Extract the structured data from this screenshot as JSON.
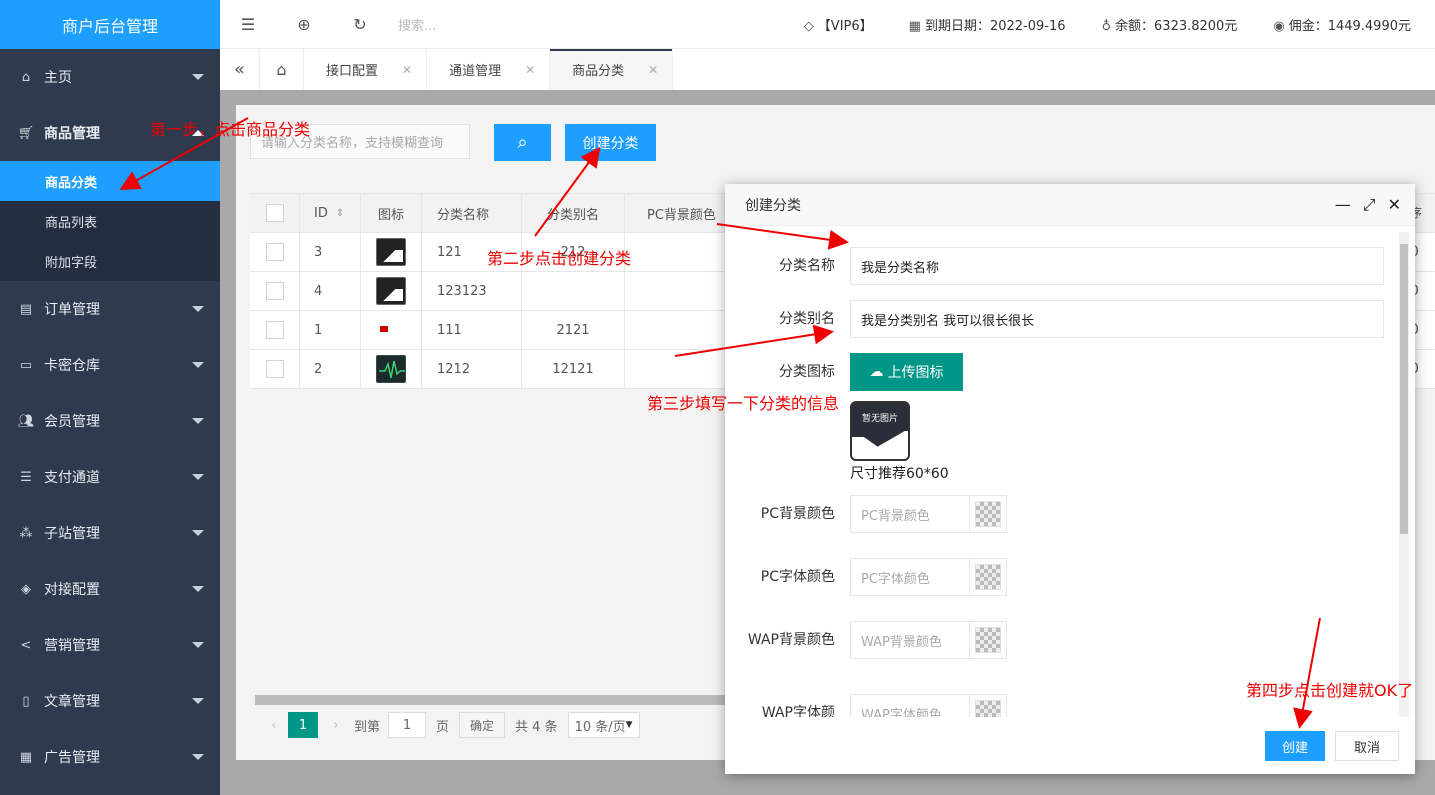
{
  "app": {
    "title": "商户后台管理"
  },
  "sidebar": {
    "items": [
      {
        "label": "主页",
        "icon": "home-icon"
      },
      {
        "label": "商品管理",
        "icon": "cart-icon",
        "expanded": true,
        "children": [
          {
            "label": "商品分类",
            "active": true
          },
          {
            "label": "商品列表"
          },
          {
            "label": "附加字段"
          }
        ]
      },
      {
        "label": "订单管理",
        "icon": "clipboard-icon"
      },
      {
        "label": "卡密仓库",
        "icon": "card-icon"
      },
      {
        "label": "会员管理",
        "icon": "users-icon"
      },
      {
        "label": "支付通道",
        "icon": "list-icon"
      },
      {
        "label": "子站管理",
        "icon": "sitemap-icon"
      },
      {
        "label": "对接配置",
        "icon": "tag-icon"
      },
      {
        "label": "营销管理",
        "icon": "share-icon"
      },
      {
        "label": "文章管理",
        "icon": "document-icon"
      },
      {
        "label": "广告管理",
        "icon": "calendar-icon"
      }
    ]
  },
  "topbar": {
    "search_placeholder": "搜索...",
    "vip": "【VIP6】",
    "expiry": "到期日期：2022-09-16",
    "balance": "余额：6323.8200元",
    "commission": "佣金：1449.4990元"
  },
  "tabs": [
    {
      "label": "接口配置",
      "active": false
    },
    {
      "label": "通道管理",
      "active": false
    },
    {
      "label": "商品分类",
      "active": true
    }
  ],
  "toolbar": {
    "search_placeholder": "请输入分类名称，支持模糊查询",
    "create_label": "创建分类"
  },
  "table": {
    "headers": {
      "id": "ID",
      "icon": "图标",
      "name": "分类名称",
      "alias": "分类别名",
      "pc_bg": "PC背景颜色",
      "sort": "序"
    },
    "rows": [
      {
        "id": "3",
        "thumb": "mtn",
        "name": "121",
        "alias": "212",
        "sort": "0"
      },
      {
        "id": "4",
        "thumb": "mtn",
        "name": "123123",
        "alias": "",
        "sort": "0"
      },
      {
        "id": "1",
        "thumb": "red",
        "name": "111",
        "alias": "2121",
        "sort": "0"
      },
      {
        "id": "2",
        "thumb": "wave",
        "name": "1212",
        "alias": "12121",
        "sort": "0"
      }
    ]
  },
  "pager": {
    "current": "1",
    "goto_label": "到第",
    "goto_value": "1",
    "page_label": "页",
    "confirm": "确定",
    "total": "共 4 条",
    "per_page": "10 条/页"
  },
  "dialog": {
    "title": "创建分类",
    "fields": {
      "name_label": "分类名称",
      "name_value": "我是分类名称",
      "alias_label": "分类别名",
      "alias_value": "我是分类别名 我可以很长很长",
      "icon_label": "分类图标",
      "upload_label": "上传图标",
      "preview_text": "暂无图片",
      "size_hint": "尺寸推荐60*60",
      "pc_bg_label": "PC背景颜色",
      "pc_bg_placeholder": "PC背景颜色",
      "pc_font_label": "PC字体颜色",
      "pc_font_placeholder": "PC字体颜色",
      "wap_bg_label": "WAP背景颜色",
      "wap_bg_placeholder": "WAP背景颜色",
      "wap_font_label": "WAP字体颜",
      "wap_font_placeholder": "WAP字体颜色"
    },
    "ok_label": "创建",
    "cancel_label": "取消"
  },
  "annotations": {
    "step1": "第一步，点击商品分类",
    "step2": "第二步点击创建分类",
    "step3": "第三步填写一下分类的信息",
    "step4": "第四步点击创建就OK了"
  },
  "colors": {
    "primary": "#1e9fff",
    "sidebar": "#2f3a4f",
    "green": "#009688",
    "annotation": "#e00000"
  }
}
